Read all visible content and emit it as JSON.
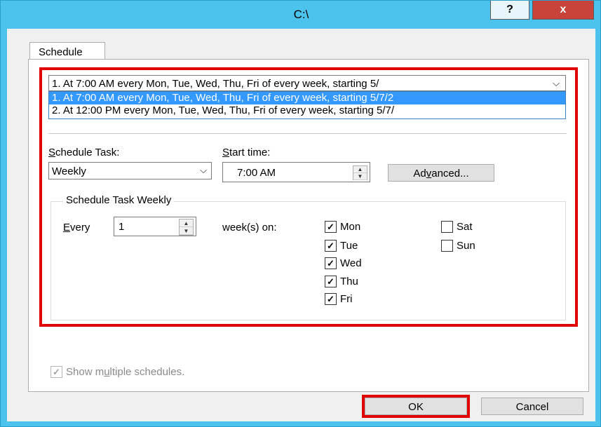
{
  "window": {
    "title": "C:\\",
    "help_glyph": "?",
    "close_glyph": "x"
  },
  "tabs": [
    {
      "label": "Schedule"
    }
  ],
  "schedule_combo": {
    "value": "1. At 7:00 AM every Mon, Tue, Wed, Thu, Fri of every week, starting 5/",
    "arrow": "⌵",
    "options": [
      "1. At 7:00 AM every Mon, Tue, Wed, Thu, Fri of every week, starting 5/7/2",
      "2. At 12:00 PM every Mon, Tue, Wed, Thu, Fri of every week, starting 5/7/"
    ]
  },
  "schedule_task": {
    "label": "Schedule Task:",
    "label_key": "S",
    "label_rest": "chedule Task:",
    "value": "Weekly",
    "arrow": "⌵"
  },
  "start_time": {
    "label_key": "S",
    "label_rest": "tart time:",
    "value": "7:00 AM"
  },
  "advanced_button": {
    "pre": "Ad",
    "key": "v",
    "post": "anced..."
  },
  "weekly_group": {
    "title": "Schedule Task Weekly",
    "every_key": "E",
    "every_rest": "very",
    "every_value": "1",
    "weeks_on_label": "week(s) on:",
    "days": [
      {
        "label": "Mon",
        "checked": "✓"
      },
      {
        "label": "Tue",
        "checked": "✓"
      },
      {
        "label": "Wed",
        "checked": "✓"
      },
      {
        "label": "Thu",
        "checked": "✓"
      },
      {
        "label": "Fri",
        "checked": "✓"
      },
      {
        "label": "Sat",
        "checked": ""
      },
      {
        "label": "Sun",
        "checked": ""
      }
    ]
  },
  "show_multiple": {
    "pre": "Show m",
    "key": "u",
    "post": "ltiple schedules.",
    "checked": "✓"
  },
  "buttons": {
    "ok": "OK",
    "cancel": "Cancel"
  },
  "spinner": {
    "up": "▲",
    "down": "▼"
  },
  "colors": {
    "titlebar": "#4bc3ec",
    "close": "#c8443a",
    "highlight": "#e00000",
    "selection": "#3399ff"
  }
}
